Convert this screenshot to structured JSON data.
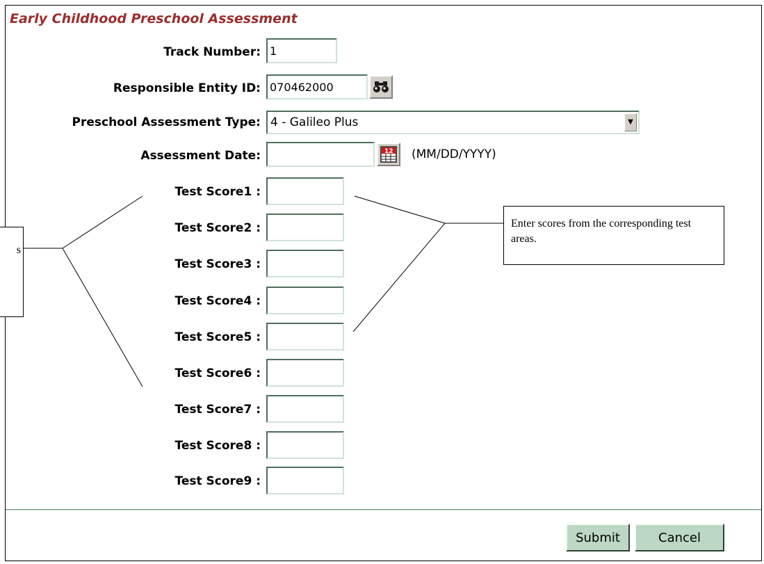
{
  "form": {
    "title": "Early Childhood Preschool Assessment",
    "track_number_label": "Track Number:",
    "track_number_value": "1",
    "entity_label": "Responsible Entity ID:",
    "entity_value": "070462000",
    "assessment_type_label": "Preschool Assessment Type:",
    "assessment_type_value": "4 - Galileo Plus",
    "assessment_date_label": "Assessment Date:",
    "assessment_date_value": "",
    "date_format_hint": "(MM/DD/YYYY)",
    "scores": [
      {
        "label": "Test Score1 :",
        "value": ""
      },
      {
        "label": "Test Score2 :",
        "value": ""
      },
      {
        "label": "Test Score3 :",
        "value": ""
      },
      {
        "label": "Test Score4 :",
        "value": ""
      },
      {
        "label": "Test Score5 :",
        "value": ""
      },
      {
        "label": "Test Score6 :",
        "value": ""
      },
      {
        "label": "Test Score7 :",
        "value": ""
      },
      {
        "label": "Test Score8 :",
        "value": ""
      },
      {
        "label": "Test Score9 :",
        "value": ""
      }
    ]
  },
  "buttons": {
    "submit": "Submit",
    "cancel": "Cancel"
  },
  "callouts": {
    "right_text": "Enter scores from the corresponding test areas.",
    "left_text_fragment": "s"
  },
  "icons": {
    "lookup": "binoculars-icon",
    "calendar": "calendar-icon",
    "dropdown": "chevron-down-icon"
  },
  "colors": {
    "title": "#9b2d2d",
    "field_border": "#4f6e5c",
    "button_bg": "#bcd8c4",
    "divider": "#7fa08a"
  }
}
